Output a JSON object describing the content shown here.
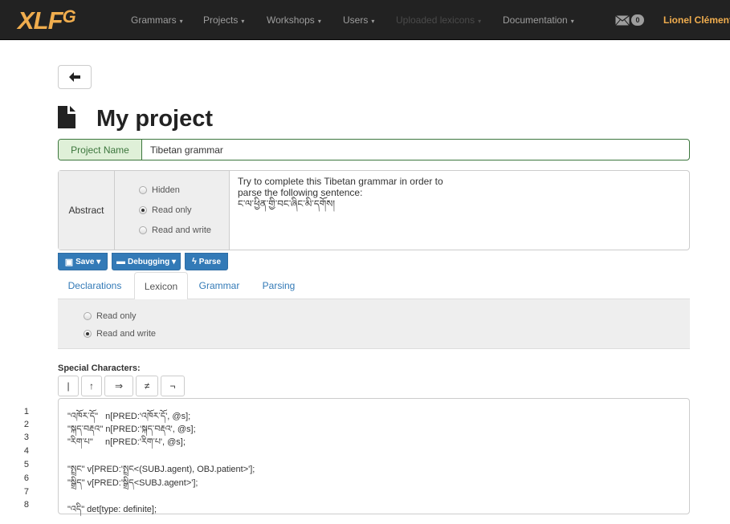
{
  "nav": {
    "brand": "XLF",
    "brand_sup": "G",
    "items": [
      {
        "label": "Grammars",
        "caret": "▾"
      },
      {
        "label": "Projects",
        "caret": "▾"
      },
      {
        "label": "Workshops",
        "caret": "▾"
      },
      {
        "label": "Users",
        "caret": "▾"
      },
      {
        "label": "Uploaded lexicons",
        "caret": "▾"
      },
      {
        "label": "Documentation",
        "caret": "▾"
      }
    ],
    "mail_icon": "envelope-icon",
    "mail_count": "0",
    "user": "Lionel Clément"
  },
  "page": {
    "title": "My project",
    "project_name_label": "Project Name",
    "project_name_value": "Tibetan grammar",
    "abstract_label": "Abstract",
    "abstract_options": [
      "Hidden",
      "Read only",
      "Read and write"
    ],
    "abstract_selected": "Read only",
    "abstract_text": [
      "Try to complete this Tibetan grammar in order to",
      "parse the following sentence:",
      "ང་ལ་ཕྱིན་གྱི་བང་ཞིང་མི་དགོས།"
    ]
  },
  "buttons": {
    "save": "Save",
    "debugging": "Debugging",
    "parse": "Parse"
  },
  "tabs": [
    "Declarations",
    "Lexicon",
    "Grammar",
    "Parsing"
  ],
  "active_tab": "Lexicon",
  "lexicon": {
    "options": [
      "Read only",
      "Read and write"
    ],
    "selected": "Read and write"
  },
  "special": {
    "title": "Special Characters:",
    "chars": [
      "|",
      "↑",
      "⇒",
      "≠",
      "¬"
    ]
  },
  "editor": {
    "line_numbers": [
      "1",
      "2",
      "3",
      "4",
      "5",
      "6",
      "7",
      "8"
    ],
    "lines": [
      "\"འཁོར་དོ\"   n[PRED:'འཁོར་དོ', @s];",
      "\"སྐད་བརྡའ\" n[PRED:'སྐད་བརྡའ', @s];",
      "\"རིག་པ\"     n[PRED:'རིག་པ', @s];",
      "",
      "\"སྤྲང\" v[PRED:'སྤྲང<(SUBJ.agent), OBJ.patient>'];",
      "\"སྒྲིད\" v[PRED:'སྒྲིད<SUBJ.agent>'];",
      "",
      "\"འདི\" det[type: definite];"
    ]
  }
}
